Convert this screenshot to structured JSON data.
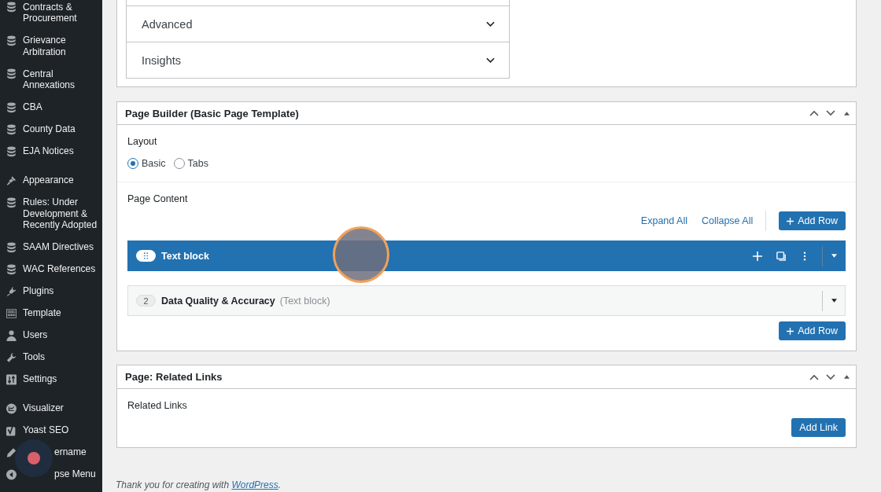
{
  "sidebar": {
    "groups": [
      [
        {
          "label": "Contracts & Procurement"
        },
        {
          "label": "Grievance Arbitration"
        },
        {
          "label": "Central Annexations"
        },
        {
          "label": "CBA"
        },
        {
          "label": "County Data"
        },
        {
          "label": "EJA Notices"
        }
      ],
      [
        {
          "label": "Appearance"
        },
        {
          "label": "Rules: Under Development & Recently Adopted"
        },
        {
          "label": "SAAM Directives"
        },
        {
          "label": "WAC References"
        },
        {
          "label": "Plugins"
        },
        {
          "label": "Template"
        },
        {
          "label": "Users"
        },
        {
          "label": "Tools"
        },
        {
          "label": "Settings"
        }
      ],
      [
        {
          "label": "Visualizer"
        },
        {
          "label": "Yoast SEO"
        },
        {
          "label": "ername",
          "obscured": true
        },
        {
          "label": "pse Menu",
          "obscured": true
        }
      ]
    ]
  },
  "accordion": [
    {
      "label": "Advanced",
      "expanded": false
    },
    {
      "label": "Insights",
      "expanded": false
    }
  ],
  "page_builder": {
    "title": "Page Builder (Basic Page Template)",
    "layout_label": "Layout",
    "layouts": [
      {
        "label": "Basic",
        "selected": true
      },
      {
        "label": "Tabs",
        "selected": false
      }
    ],
    "content_label": "Page Content",
    "expand_all": "Expand All",
    "collapse_all": "Collapse All",
    "add_row": "Add Row",
    "rows": [
      {
        "selected": true,
        "title": "Text block"
      },
      {
        "selected": false,
        "number": "2",
        "title": "Data Quality & Accuracy",
        "type": "(Text block)"
      }
    ],
    "add_row_bottom": "Add Row"
  },
  "related_links": {
    "title": "Page: Related Links",
    "label": "Related Links",
    "add_link": "Add Link"
  },
  "footer": {
    "text": "Thank you for creating with ",
    "link": "WordPress",
    "end": "."
  }
}
